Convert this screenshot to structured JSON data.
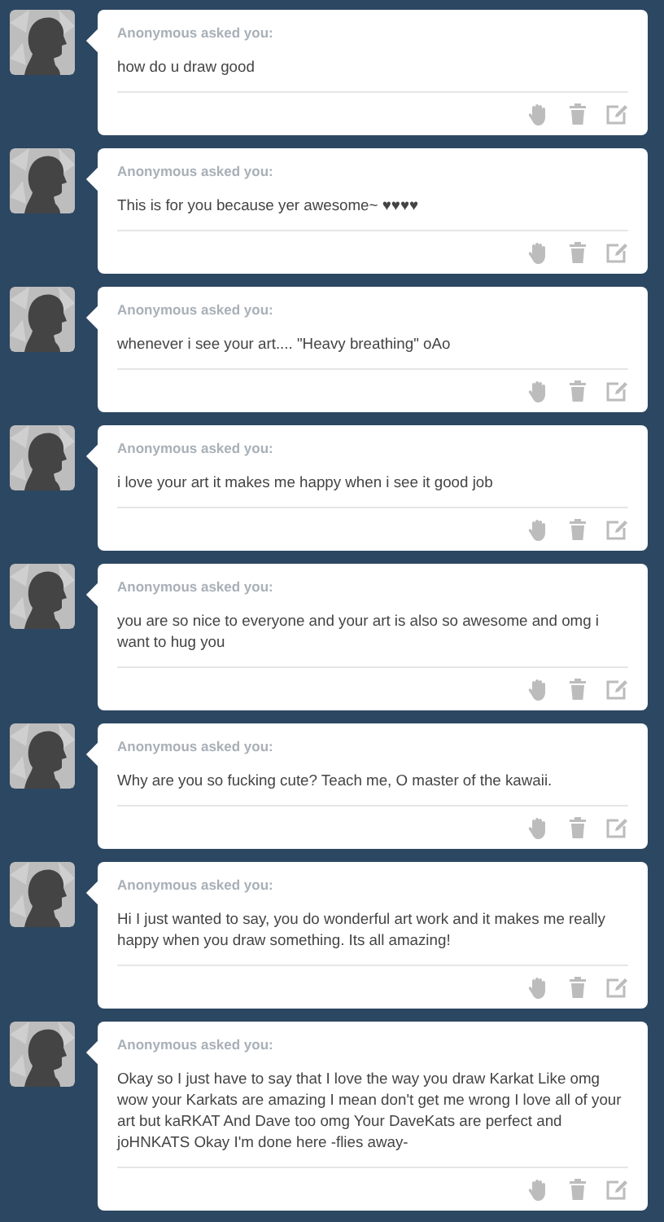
{
  "posts": [
    {
      "asker": "Anonymous asked you:",
      "question": "how do u draw good"
    },
    {
      "asker": "Anonymous asked you:",
      "question": "This is for you because yer awesome~ ♥♥♥♥"
    },
    {
      "asker": "Anonymous asked you:",
      "question": "whenever i see your art.... \"Heavy breathing\" oAo"
    },
    {
      "asker": "Anonymous asked you:",
      "question": "i love your art it makes me happy when i see it good job"
    },
    {
      "asker": "Anonymous asked you:",
      "question": "you are so nice to everyone and your art is also so awesome and omg i want to hug you"
    },
    {
      "asker": "Anonymous asked you:",
      "question": "Why are you so fucking cute? Teach me, O master of the kawaii."
    },
    {
      "asker": "Anonymous asked you:",
      "question": "Hi I just wanted to say, you do wonderful art work and it makes me really happy when you draw something. Its all amazing!"
    },
    {
      "asker": "Anonymous asked you:",
      "question": "Okay so I just have to say that I love the way you draw Karkat Like omg wow your Karkats are amazing I mean don't get me wrong I love all of your art but kaRKAT And Dave too omg Your DaveKats are perfect and joHNKATS Okay I'm done here -flies away-"
    }
  ]
}
